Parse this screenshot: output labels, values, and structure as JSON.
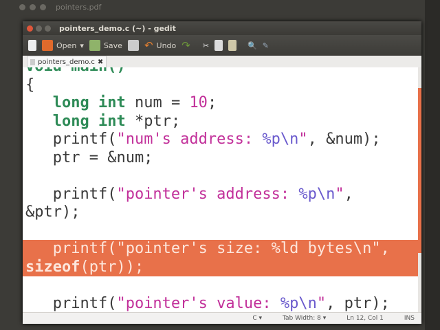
{
  "background_window": {
    "title": "pointers.pdf"
  },
  "window": {
    "title": "pointers_demo.c (~) - gedit"
  },
  "toolbar": {
    "open": "Open",
    "save": "Save",
    "undo": "Undo"
  },
  "tab": {
    "label": "pointers_demo.c"
  },
  "code": {
    "lines": [
      [
        {
          "t": "void main()",
          "c": "kw"
        }
      ],
      [
        {
          "t": "{"
        }
      ],
      [
        {
          "t": "   "
        },
        {
          "t": "long int",
          "c": "kw"
        },
        {
          "t": " num = "
        },
        {
          "t": "10",
          "c": "st"
        },
        {
          "t": ";"
        }
      ],
      [
        {
          "t": "   "
        },
        {
          "t": "long int",
          "c": "kw"
        },
        {
          "t": " *ptr;"
        }
      ],
      [
        {
          "t": "   printf("
        },
        {
          "t": "\"num's address: ",
          "c": "st"
        },
        {
          "t": "%p\\n",
          "c": "fm"
        },
        {
          "t": "\"",
          "c": "st"
        },
        {
          "t": ", &num);"
        }
      ],
      [
        {
          "t": "   ptr = &num;"
        }
      ],
      [
        {
          "t": ""
        }
      ],
      [
        {
          "t": "   printf("
        },
        {
          "t": "\"pointer's address: ",
          "c": "st"
        },
        {
          "t": "%p\\n",
          "c": "fm"
        },
        {
          "t": "\"",
          "c": "st"
        },
        {
          "t": ","
        }
      ],
      [
        {
          "t": "&ptr);"
        }
      ],
      [
        {
          "t": ""
        }
      ],
      [
        {
          "t": "   printf("
        },
        {
          "t": "\"pointer's size: ",
          "c": "st"
        },
        {
          "t": "%ld",
          "c": "fm"
        },
        {
          "t": " bytes",
          "c": "st"
        },
        {
          "t": "\\n",
          "c": "fm"
        },
        {
          "t": "\",",
          "c": "st"
        }
      ],
      [
        {
          "t": "sizeof",
          "c": "kw"
        },
        {
          "t": "(ptr));"
        }
      ],
      [
        {
          "t": ""
        }
      ],
      [
        {
          "t": "   printf("
        },
        {
          "t": "\"pointer's value: ",
          "c": "st"
        },
        {
          "t": "%p\\n",
          "c": "fm"
        },
        {
          "t": "\"",
          "c": "st"
        },
        {
          "t": ", ptr);"
        }
      ]
    ],
    "highlighted_lines": [
      10,
      11
    ]
  },
  "status": {
    "language": "C ▾",
    "tab_width": "Tab Width: 8 ▾",
    "position": "Ln 12, Col 1",
    "mode": "INS"
  },
  "colors": {
    "highlight": "#e8714a",
    "keyword": "#2e8b57",
    "string": "#c2309a",
    "format": "#6a5acd"
  }
}
